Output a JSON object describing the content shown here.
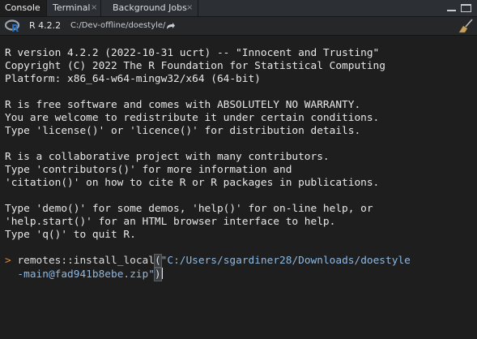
{
  "tabs": [
    {
      "label": "Console",
      "closable": false,
      "active": true
    },
    {
      "label": "Terminal",
      "closable": true,
      "active": false
    },
    {
      "label": "Background Jobs",
      "closable": true,
      "active": false
    }
  ],
  "close_glyph": "×",
  "toolbar": {
    "r_version": "R 4.2.2",
    "working_dir": "C:/Dev-offline/doestyle/",
    "icons": [
      "r-logo-icon",
      "go-to-directory-icon",
      "clear-console-icon"
    ]
  },
  "console": {
    "banner": [
      "R version 4.2.2 (2022-10-31 ucrt) -- \"Innocent and Trusting\"",
      "Copyright (C) 2022 The R Foundation for Statistical Computing",
      "Platform: x86_64-w64-mingw32/x64 (64-bit)",
      "",
      "R is free software and comes with ABSOLUTELY NO WARRANTY.",
      "You are welcome to redistribute it under certain conditions.",
      "Type 'license()' or 'licence()' for distribution details.",
      "",
      "R is a collaborative project with many contributors.",
      "Type 'contributors()' for more information and",
      "'citation()' on how to cite R or R packages in publications.",
      "",
      "Type 'demo()' for some demos, 'help()' for on-line help, or",
      "'help.start()' for an HTML browser interface to help.",
      "Type 'q()' to quit R."
    ],
    "prompt": ">",
    "input": {
      "function_call": "remotes::install_local",
      "open_paren": "(",
      "string_line1": "\"C:/Users/sgardiner28/Downloads/doestyle",
      "string_line2": "-main@fad941b8ebe.zip\"",
      "close_paren": ")"
    }
  },
  "colors": {
    "background": "#1e1e1e",
    "text": "#e8e8e8",
    "prompt": "#e08a2e",
    "string": "#8fb8e0",
    "tab_bar": "#2c3035"
  }
}
